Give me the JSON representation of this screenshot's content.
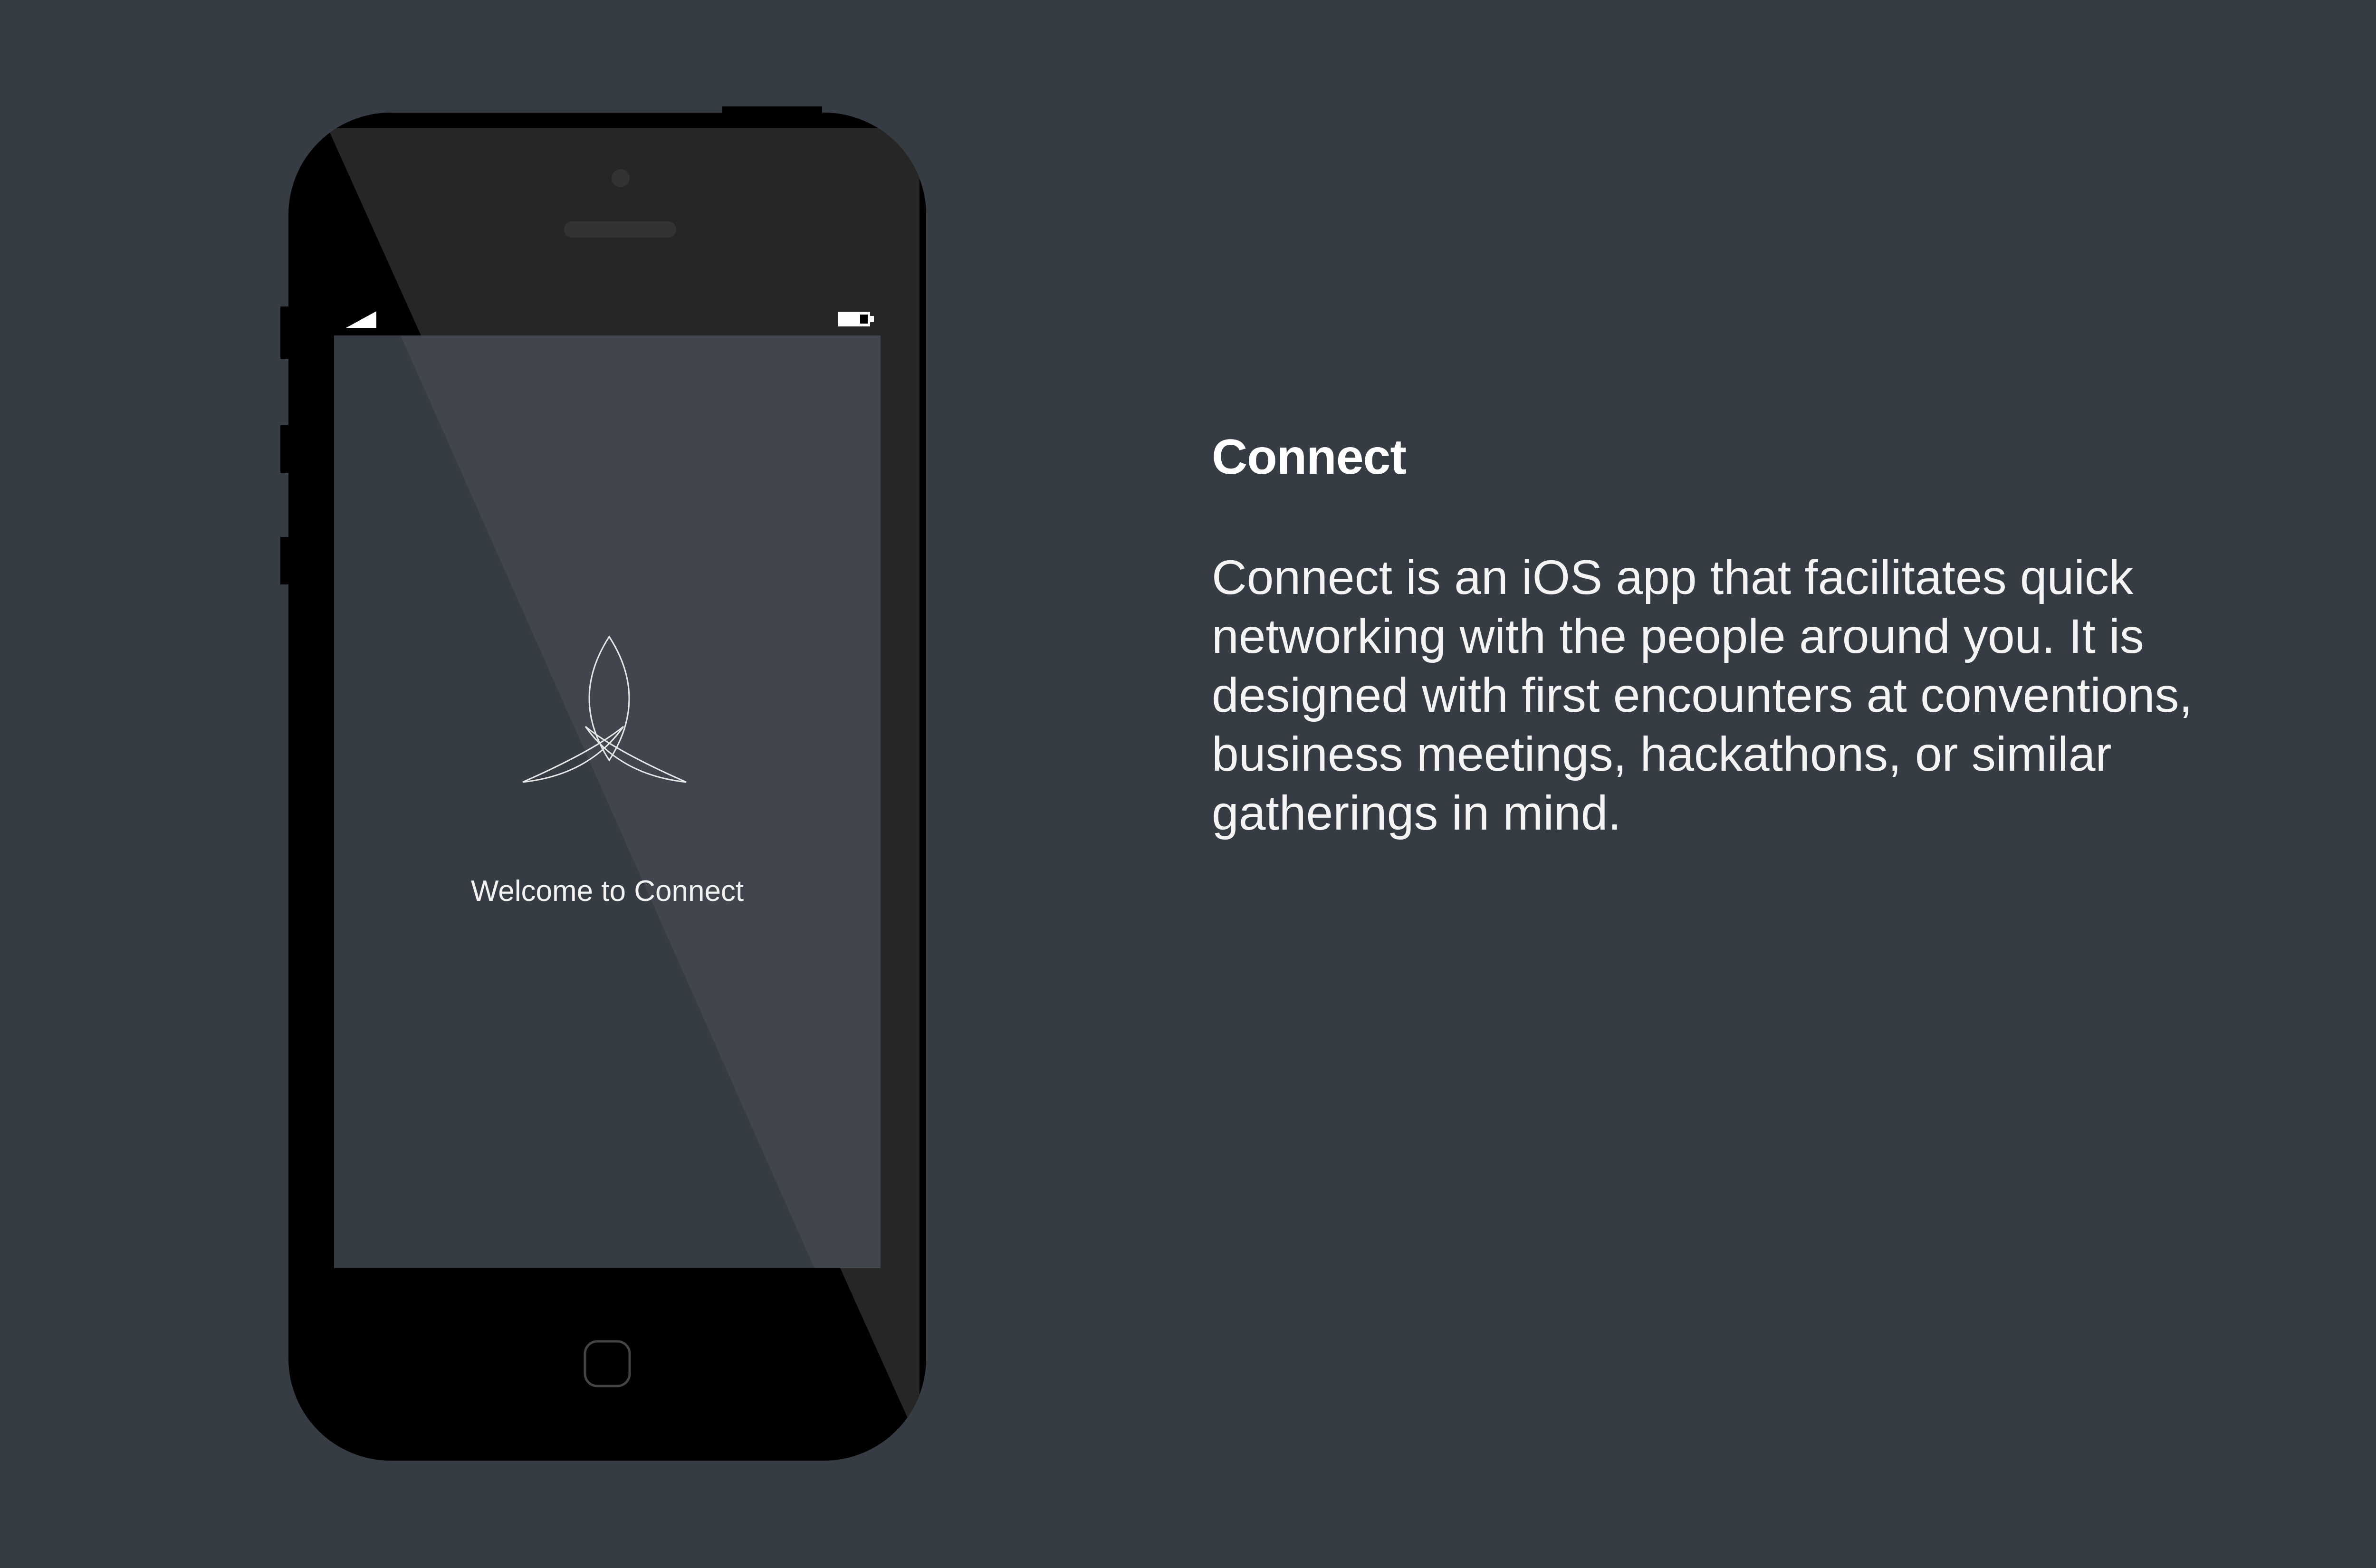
{
  "app": {
    "welcome_text": "Welcome to Connect"
  },
  "info": {
    "title": "Connect",
    "description": "Connect is an iOS app that facilitates quick networking with the people around you. It is designed with first encounters at conventions, business meetings, hackathons, or similar gatherings in mind."
  },
  "status_bar": {
    "signal_icon": "signal-icon",
    "battery_icon": "battery-icon"
  },
  "colors": {
    "background": "#363c43",
    "phone_body": "#000000",
    "screen": "#3f454d",
    "accent_text": "#ffffff"
  }
}
